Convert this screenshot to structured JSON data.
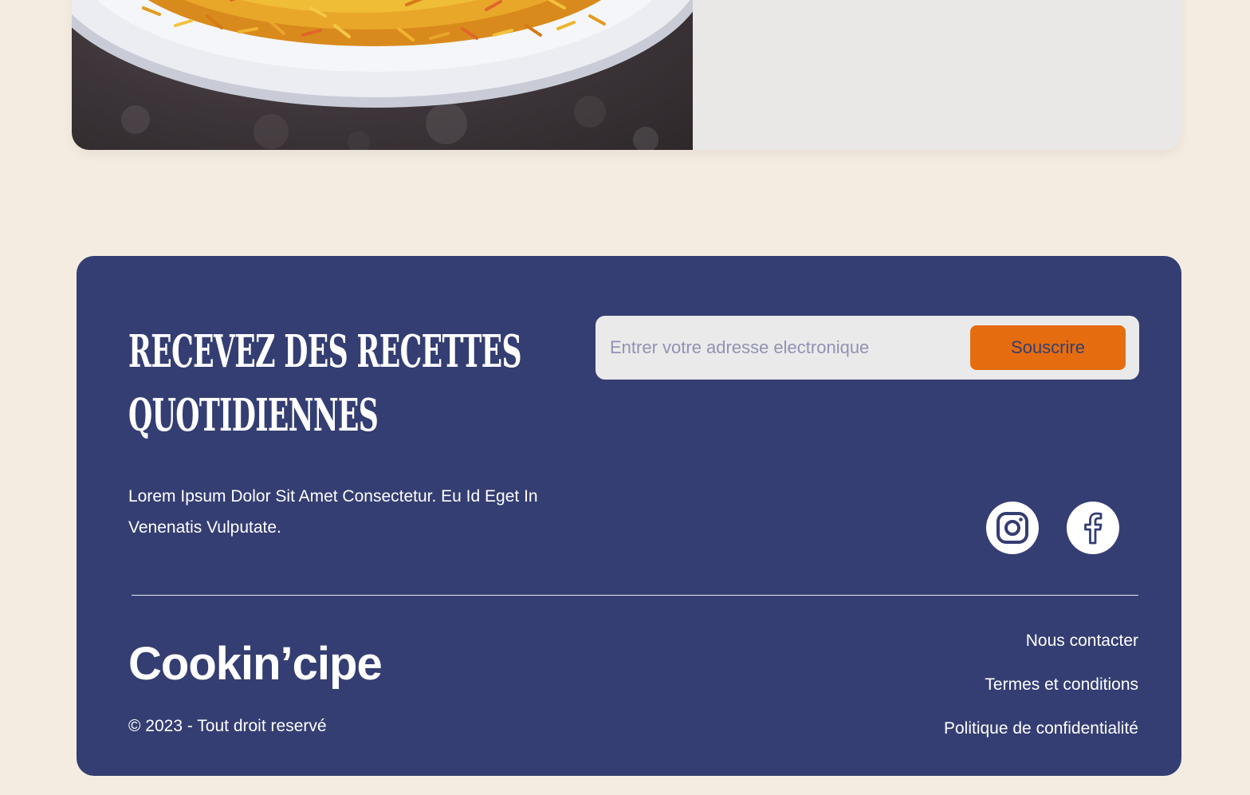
{
  "recipe_card": {
    "image_icon": "plate-of-rice-photo"
  },
  "newsletter": {
    "title_line1": "Recevez des recettes",
    "title_line2": "quotidiennes",
    "email_placeholder": "Entrer votre adresse electronique",
    "subscribe_label": "Souscrire",
    "description": "Lorem Ipsum Dolor Sit Amet Consectetur. Eu Id Eget In Venenatis Vulputate."
  },
  "social": {
    "instagram_icon": "instagram-icon",
    "facebook_icon": "facebook-icon"
  },
  "footer": {
    "brand": "Cookin’cipe",
    "copyright": "© 2023 - Tout droit reservé",
    "links": [
      {
        "label": "Nous contacter"
      },
      {
        "label": "Termes et conditions"
      },
      {
        "label": "Politique de confidentialité"
      }
    ]
  },
  "colors": {
    "page_bg": "#f4ece1",
    "footer_bg": "#343e72",
    "accent": "#e56d0f",
    "input_bg": "#ebeaea"
  }
}
